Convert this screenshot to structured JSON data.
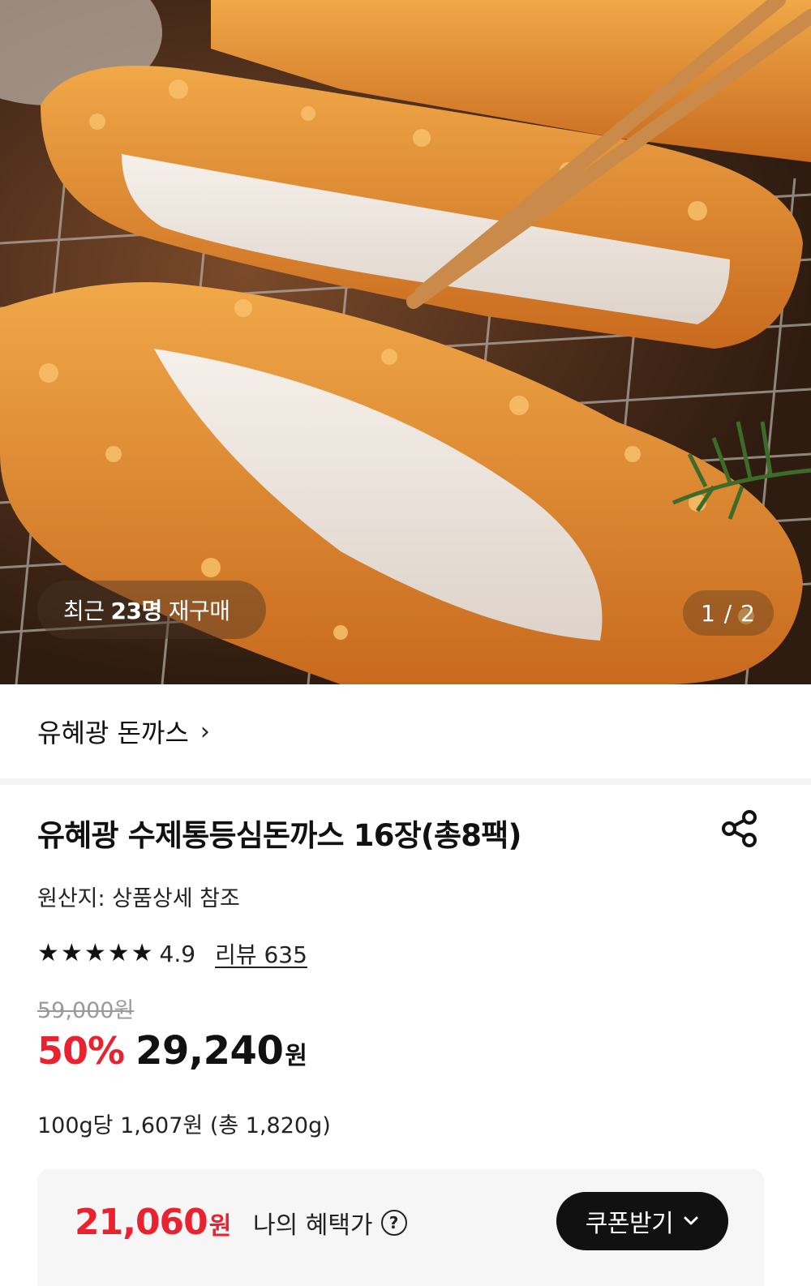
{
  "hero": {
    "repurchase_prefix": "최근",
    "repurchase_count": "23명",
    "repurchase_suffix": "재구매",
    "image_counter": "1 / 2"
  },
  "brand": {
    "name": "유혜광 돈까스",
    "chevron": "›"
  },
  "product": {
    "title": "유혜광 수제통등심돈까스 16장(총8팩)",
    "origin": "원산지: 상품상세 참조",
    "rating": "4.9",
    "review_link": "리뷰 635",
    "original_price": "59,000원",
    "discount_rate": "50%",
    "sale_price": "29,240",
    "currency": "원",
    "unit_price": "100g당 1,607원 (총 1,820g)"
  },
  "benefit": {
    "price": "21,060",
    "currency": "원",
    "label": "나의 혜택가",
    "help_glyph": "?",
    "coupon_button": "쿠폰받기"
  },
  "icons": {
    "share": "share-icon",
    "star": "★",
    "chevron_down": "chevron-down-icon"
  },
  "colors": {
    "accent_red": "#e8232f",
    "button_dark": "#111111",
    "benefit_bg": "#f6f6f6"
  }
}
